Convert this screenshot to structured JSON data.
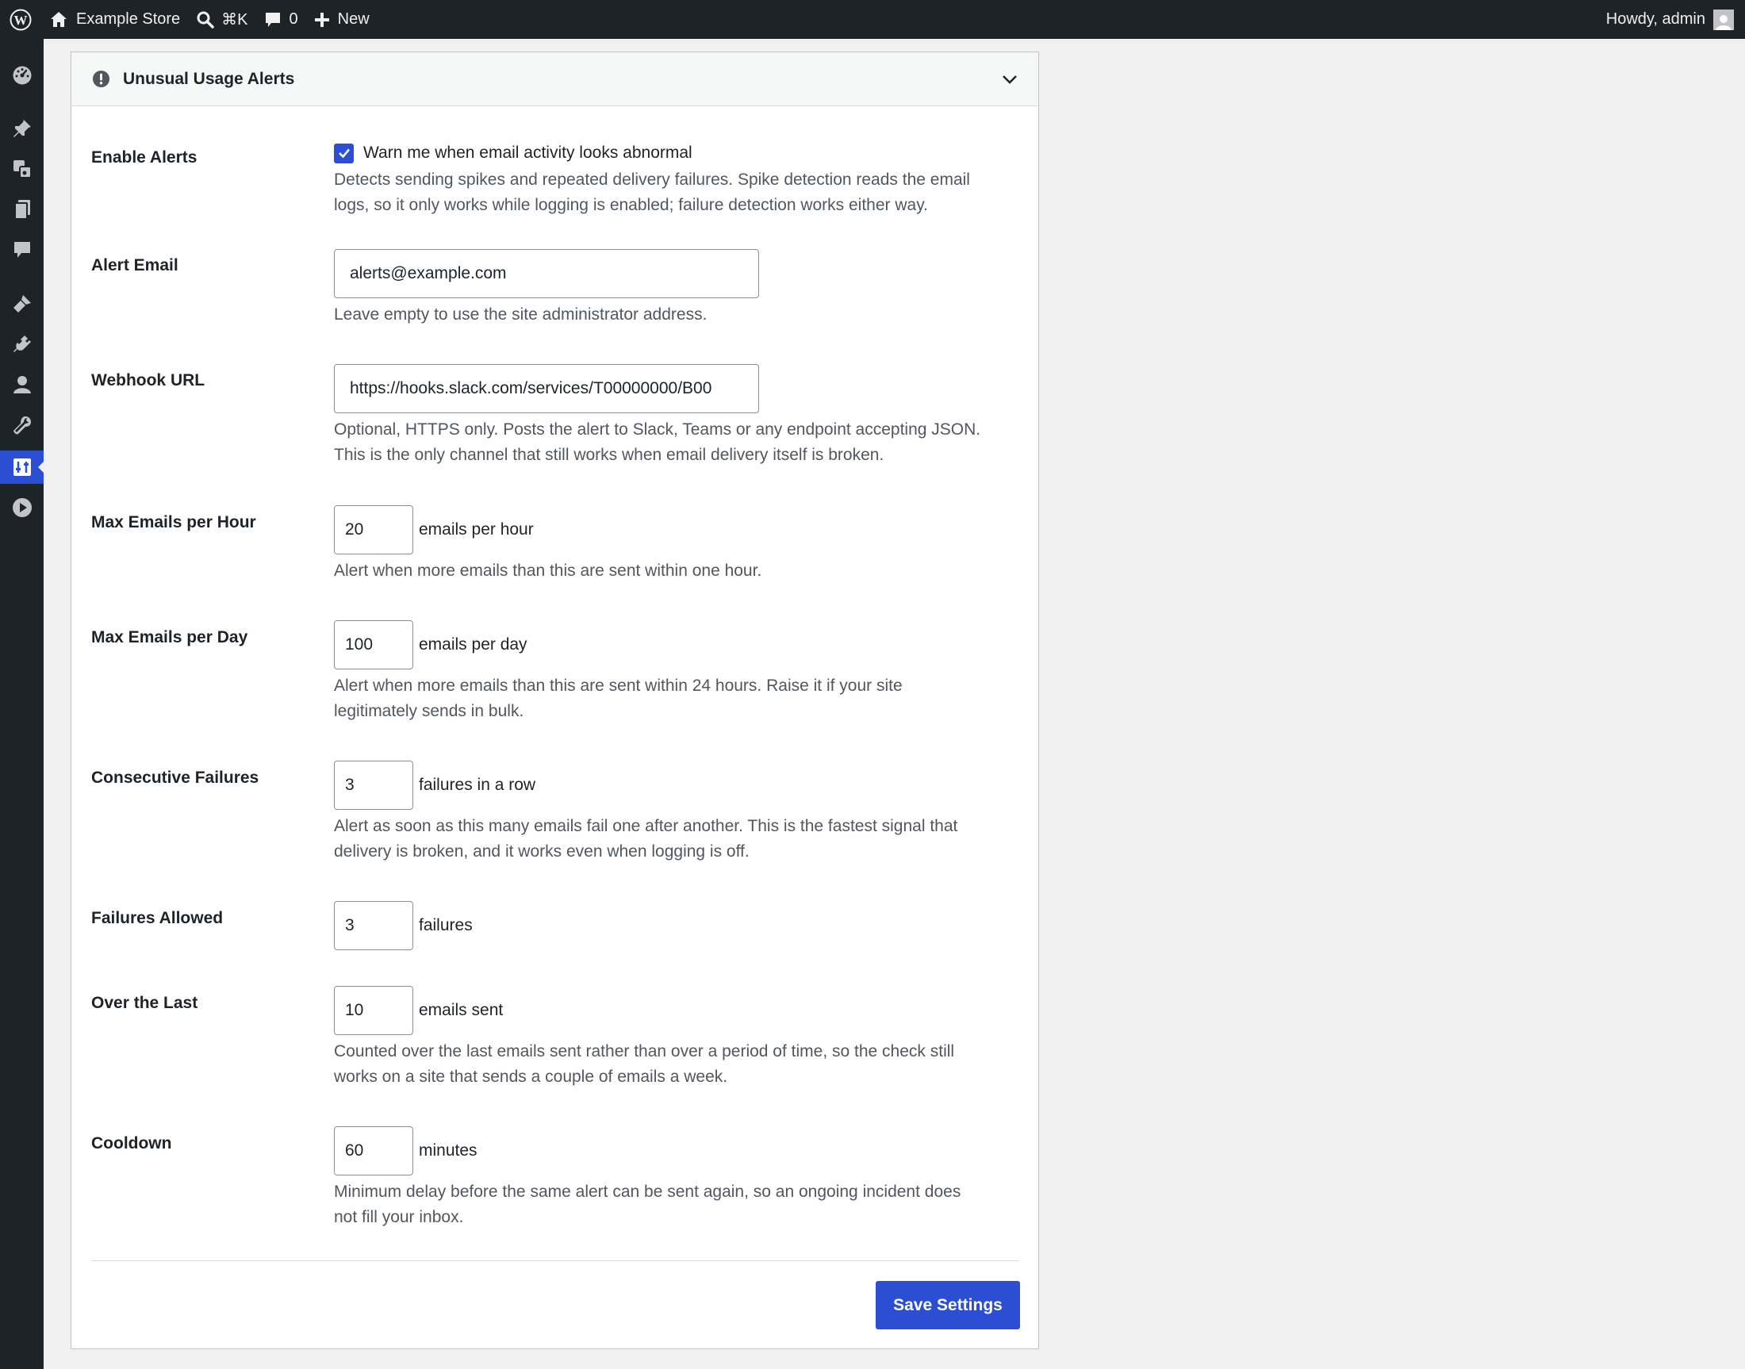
{
  "adminbar": {
    "site_name": "Example Store",
    "search_shortcut": "⌘K",
    "comments_count": "0",
    "new_label": "New",
    "greeting": "Howdy, admin"
  },
  "menu": {
    "icons": [
      "dashboard-icon",
      "posts-icon",
      "media-icon",
      "pages-icon",
      "comments-icon",
      "appearance-icon",
      "plugins-icon",
      "users-icon",
      "tools-icon",
      "settings-icon",
      "media-player-icon"
    ],
    "current": "settings-icon"
  },
  "panel": {
    "title": "Unusual Usage Alerts"
  },
  "fields": {
    "enable_alerts": {
      "label": "Enable Alerts",
      "checked": true,
      "checkbox_label": "Warn me when email activity looks abnormal",
      "desc_1": "Detects sending spikes and repeated delivery failures. Spike detection reads the email",
      "desc_2": "logs, so it only works while logging is enabled; failure detection works either way."
    },
    "alert_email": {
      "label": "Alert Email",
      "value": "alerts@example.com",
      "desc_1": "Leave empty to use the site administrator address."
    },
    "webhook_url": {
      "label": "Webhook URL",
      "value": "https://hooks.slack.com/services/T00000000/B00",
      "desc_1": "Optional, HTTPS only. Posts the alert to Slack, Teams or any endpoint accepting JSON.",
      "desc_2": "This is the only channel that still works when email delivery itself is broken."
    },
    "max_per_hour": {
      "label": "Max Emails per Hour",
      "value": "20",
      "unit": "emails per hour",
      "desc_1": "Alert when more emails than this are sent within one hour."
    },
    "max_per_day": {
      "label": "Max Emails per Day",
      "value": "100",
      "unit": "emails per day",
      "desc_1": "Alert when more emails than this are sent within 24 hours. Raise it if your site",
      "desc_2": "legitimately sends in bulk."
    },
    "consecutive_failures": {
      "label": "Consecutive Failures",
      "value": "3",
      "unit": "failures in a row",
      "desc_1": "Alert as soon as this many emails fail one after another. This is the fastest signal that",
      "desc_2": "delivery is broken, and it works even when logging is off."
    },
    "failures_allowed": {
      "label": "Failures Allowed",
      "value": "3",
      "unit": "failures"
    },
    "over_the_last": {
      "label": "Over the Last",
      "value": "10",
      "unit": "emails sent",
      "desc_1": "Counted over the last emails sent rather than over a period of time, so the check still",
      "desc_2": "works on a site that sends a couple of emails a week."
    },
    "cooldown": {
      "label": "Cooldown",
      "value": "60",
      "unit": "minutes",
      "desc_1": "Minimum delay before the same alert can be sent again, so an ongoing incident does",
      "desc_2": "not fill your inbox."
    }
  },
  "save_label": "Save Settings",
  "colors": {
    "accent": "#2c4ed3",
    "adminbar_bg": "#1d2327",
    "page_bg": "#f0f0f1"
  }
}
